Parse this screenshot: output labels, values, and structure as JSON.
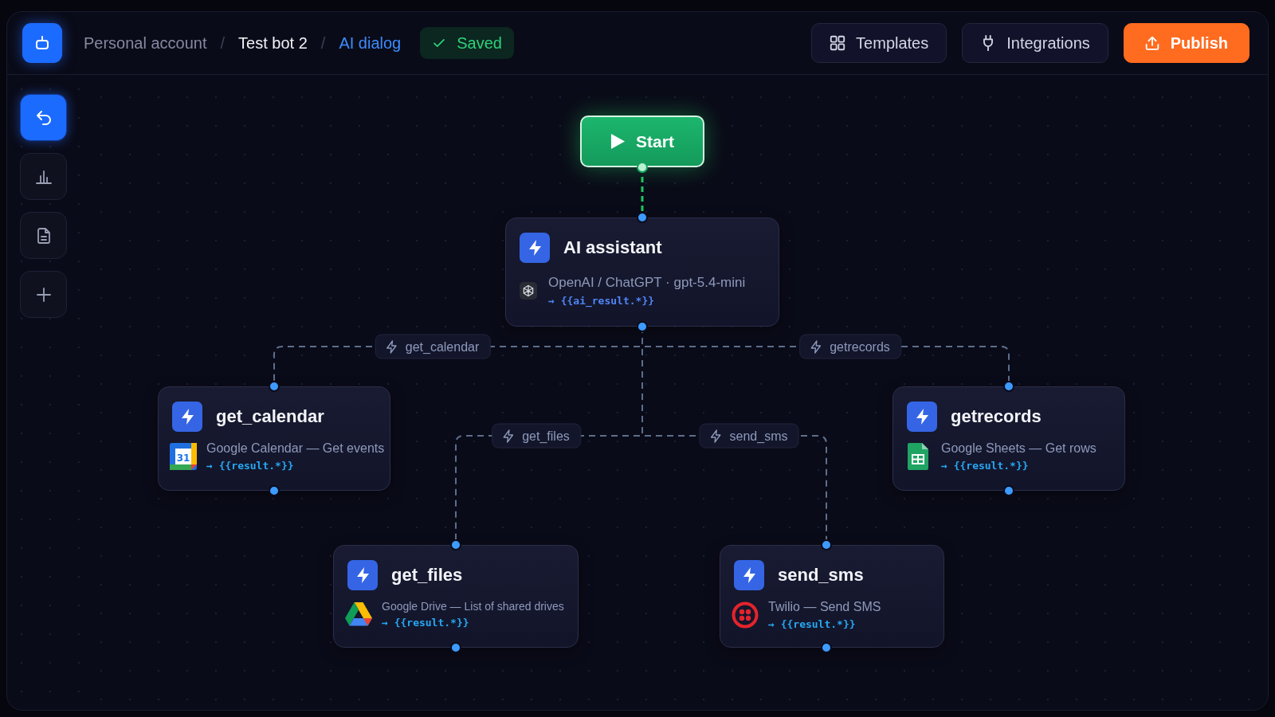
{
  "header": {
    "breadcrumb": [
      {
        "label": "Personal account",
        "kind": "account"
      },
      {
        "label": "/",
        "kind": "separator"
      },
      {
        "label": "Test bot 2",
        "kind": "bot"
      },
      {
        "label": "/",
        "kind": "separator"
      },
      {
        "label": "AI dialog",
        "kind": "page"
      }
    ],
    "save_status": "Saved",
    "buttons": [
      {
        "label": "Templates",
        "kind": "secondary"
      },
      {
        "label": "Integrations",
        "kind": "secondary"
      },
      {
        "label": "Publish",
        "kind": "primary"
      }
    ]
  },
  "sidebar": {
    "items": [
      {
        "selected": true
      },
      {
        "selected": false
      },
      {
        "selected": false
      },
      {
        "selected": false
      }
    ]
  },
  "flow": {
    "start": {
      "label": "Start"
    },
    "agent": {
      "title": "AI assistant",
      "service": "OpenAI / ChatGPT · gpt-5.4-mini",
      "output": "→ {{ai_result.*}}"
    },
    "tools": [
      {
        "edge_label": "get_calendar",
        "title": "get_calendar",
        "kind": "calendar",
        "icon_label": "31",
        "service": "Google Calendar — Get events",
        "output": "→ {{result.*}}"
      },
      {
        "edge_label": "getrecords",
        "title": "getrecords",
        "kind": "sheets",
        "service": "Google Sheets — Get rows",
        "output": "→ {{result.*}}"
      },
      {
        "edge_label": "get_files",
        "title": "get_files",
        "kind": "drive",
        "service": "Google Drive — List of shared drives",
        "output": "→ {{result.*}}"
      },
      {
        "edge_label": "send_sms",
        "title": "send_sms",
        "kind": "sms",
        "service": "Twilio — Send SMS",
        "output": "→ {{result.*}}"
      }
    ]
  }
}
